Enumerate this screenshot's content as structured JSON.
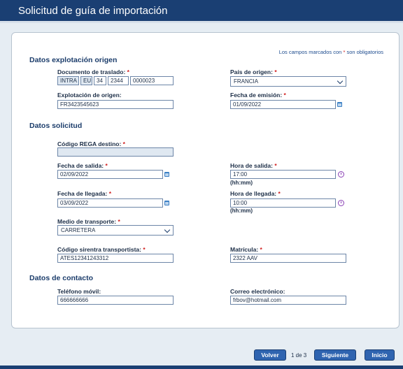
{
  "page_title": "Solicitud de guía de importación",
  "required_note": {
    "text": "Los campos marcados con",
    "asterisk": "*",
    "suffix": "son obligatorios"
  },
  "sections": {
    "origen": "Datos explotación origen",
    "solicitud": "Datos solicitud",
    "contacto": "Datos de contacto"
  },
  "required_marker": "*",
  "fields": {
    "documento_traslado": {
      "label": "Documento de traslado:",
      "parts": [
        "INTRA",
        "EU",
        "34",
        "2344",
        "0000023"
      ]
    },
    "pais_origen": {
      "label": "País de origen:",
      "value": "FRANCIA"
    },
    "explotacion_origen": {
      "label": "Explotación de origen:",
      "value": "FR3423545623"
    },
    "fecha_emision": {
      "label": "Fecha de emisión:",
      "value": "01/09/2022"
    },
    "codigo_rega": {
      "label": "Código REGA destino:",
      "value": ""
    },
    "fecha_salida": {
      "label": "Fecha de salida:",
      "value": "02/09/2022"
    },
    "hora_salida": {
      "label": "Hora de salida:",
      "value": "17:00",
      "hint": "(hh:mm)"
    },
    "fecha_llegada": {
      "label": "Fecha de llegada:",
      "value": "03/09/2022"
    },
    "hora_llegada": {
      "label": "Hora de llegada:",
      "value": "10:00",
      "hint": "(hh:mm)"
    },
    "medio_transporte": {
      "label": "Medio de transporte:",
      "value": "CARRETERA"
    },
    "codigo_sirentra": {
      "label": "Código sirentra transportista:",
      "value": "ATES12341243312"
    },
    "matricula": {
      "label": "Matrícula:",
      "value": "2322 AAV"
    },
    "telefono": {
      "label": "Teléfono móvil:",
      "value": "666666666"
    },
    "correo": {
      "label": "Correo electrónico:",
      "value": "frbov@hotmail.com"
    }
  },
  "footer": {
    "back_label": "Volver",
    "page_indicator": "1 de 3",
    "next_label": "Siguiente",
    "home_label": "Inicio"
  },
  "icons": [
    "calendar-icon",
    "clock-icon",
    "chevron-down-icon"
  ],
  "colors": {
    "header": "#1a3f73",
    "button": "#2f64b0",
    "required": "#d01c1c",
    "clock": "#8a3fb5"
  }
}
